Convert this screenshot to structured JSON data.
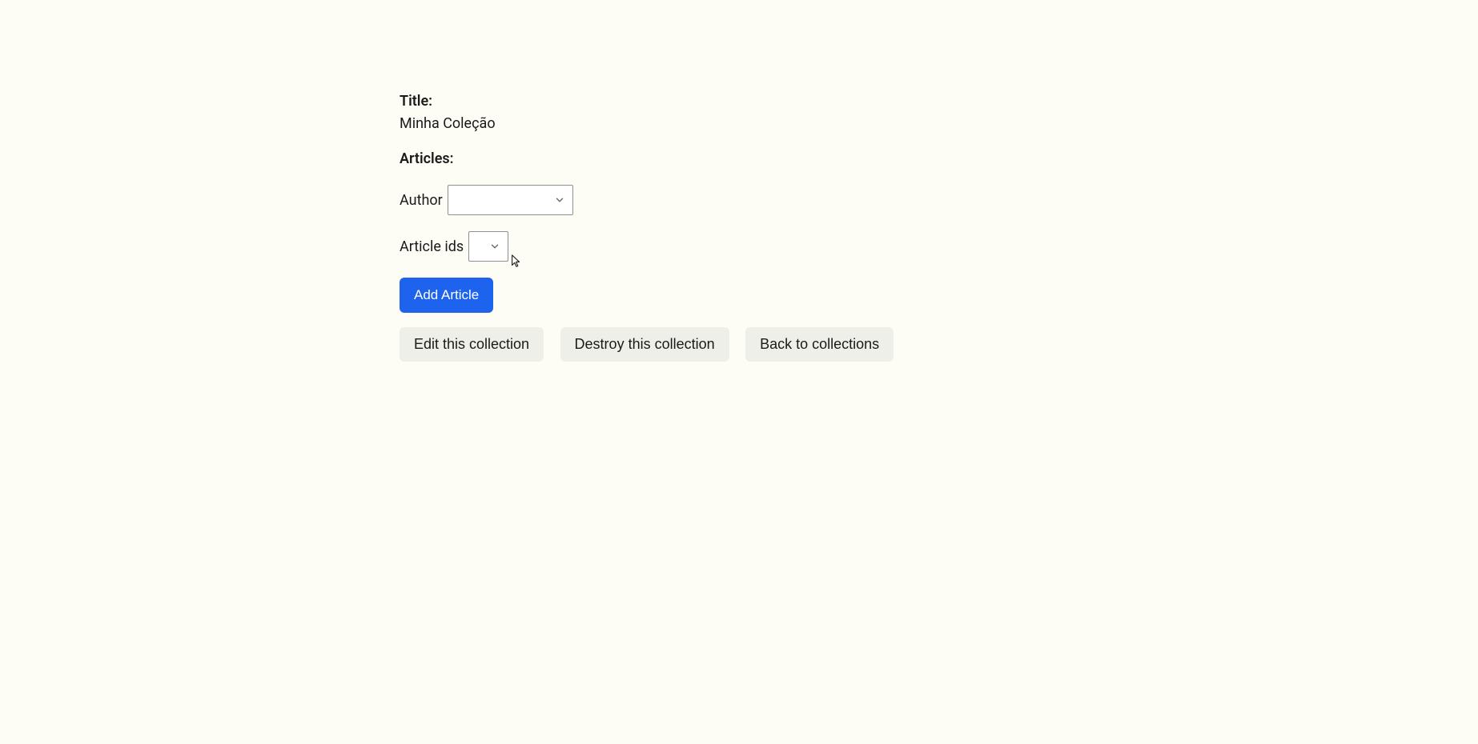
{
  "fields": {
    "title_label": "Title:",
    "title_value": "Minha Coleção",
    "articles_label": "Articles:"
  },
  "form": {
    "author_label": "Author",
    "author_selected": "",
    "article_ids_label": "Article ids",
    "article_ids_selected": "",
    "add_article_button": "Add Article"
  },
  "actions": {
    "edit": "Edit this collection",
    "destroy": "Destroy this collection",
    "back": "Back to collections"
  }
}
